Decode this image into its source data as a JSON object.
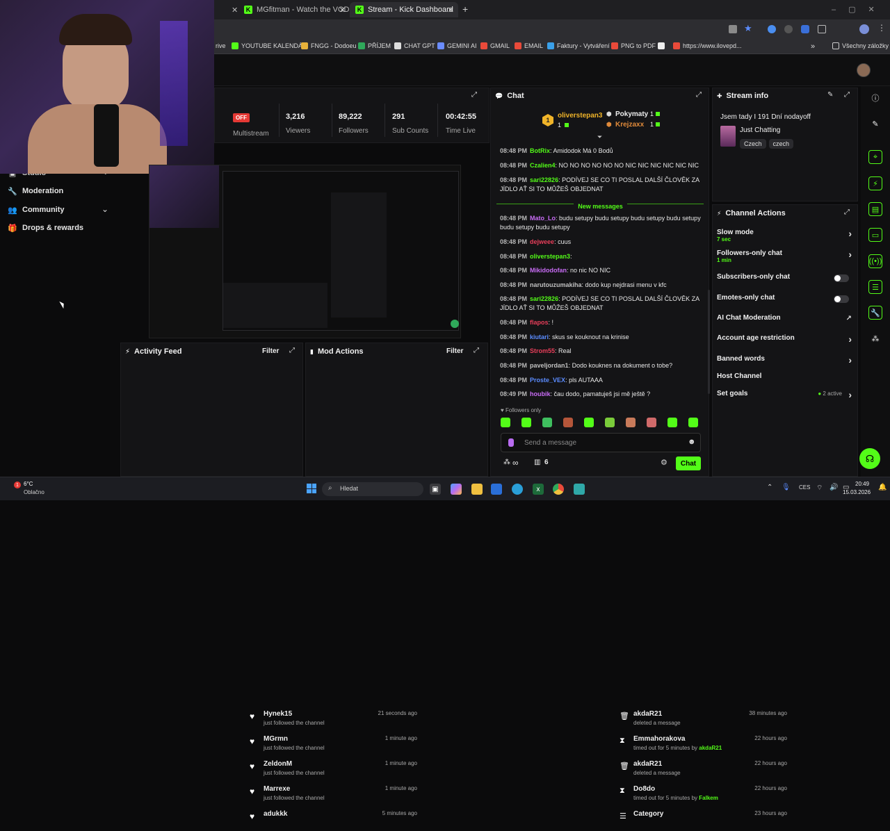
{
  "browser": {
    "tabs": [
      {
        "label": "MGfitman - Watch the VOD on"
      },
      {
        "label": "Stream - Kick Dashboard"
      }
    ],
    "new_tab": "+",
    "bookmarks": [
      "rive",
      "YOUTUBE KALENDÁŘ",
      "FNGG - Dodoeu",
      "PŘÍJEM",
      "CHAT GPT",
      "GEMINI AI",
      "GMAIL",
      "EMAIL",
      "Faktury - Vytváření",
      "PNG to PDF",
      "https://www.ilovepd...",
      "Všechny záložky"
    ],
    "more_bookmarks": "»"
  },
  "sidebar": {
    "partial": "Studio",
    "items": [
      {
        "label": "Moderation",
        "icon": "wrench-icon"
      },
      {
        "label": "Community",
        "icon": "people-icon"
      },
      {
        "label": "Drops & rewards",
        "icon": "gift-icon"
      }
    ]
  },
  "stats": {
    "off_badge": "OFF",
    "multistream": "Multistream",
    "items": [
      {
        "value": "3,216",
        "label": "Viewers"
      },
      {
        "value": "89,222",
        "label": "Followers"
      },
      {
        "value": "291",
        "label": "Sub Counts"
      },
      {
        "value": "00:42:55",
        "label": "Time Live"
      }
    ]
  },
  "activity_feed": {
    "title": "Activity Feed",
    "filter": "Filter",
    "items": [
      {
        "name": "Hynek15",
        "action": "just followed the channel",
        "time": "21 seconds ago"
      },
      {
        "name": "MGrmn",
        "action": "just followed the channel",
        "time": "1 minute ago"
      },
      {
        "name": "ZeldonM",
        "action": "just followed the channel",
        "time": "1 minute ago"
      },
      {
        "name": "Marrexe",
        "action": "just followed the channel",
        "time": "1 minute ago"
      },
      {
        "name": "adukkk",
        "action": "",
        "time": "5 minutes ago"
      }
    ]
  },
  "mod_actions": {
    "title": "Mod Actions",
    "filter": "Filter",
    "items": [
      {
        "name": "akdaR21",
        "action": "deleted a message",
        "by": "",
        "time": "38 minutes ago",
        "icon": "trash-icon"
      },
      {
        "name": "Emmahorakova",
        "action": "timed out for 5 minutes by",
        "by": "akdaR21",
        "time": "22 hours ago",
        "icon": "hourglass-icon"
      },
      {
        "name": "akdaR21",
        "action": "deleted a message",
        "by": "",
        "time": "22 hours ago",
        "icon": "trash-icon"
      },
      {
        "name": "Do8do",
        "action": "timed out for 5 minutes by",
        "by": "Falkem",
        "time": "22 hours ago",
        "icon": "hourglass-icon"
      },
      {
        "name": "Category",
        "action": "",
        "by": "",
        "time": "23 hours ago",
        "icon": "list-icon"
      }
    ]
  },
  "chat": {
    "title": "Chat",
    "top_gifters": [
      {
        "rank": "1",
        "name": "oliverstepan3",
        "count": "1"
      },
      {
        "name": "Pokymaty",
        "count": "1"
      },
      {
        "name": "Krejzaxx",
        "count": "1"
      }
    ],
    "new_messages": "New messages",
    "messages_before": [
      {
        "time": "08:48 PM",
        "user": "BotRix",
        "color": "#53fc18",
        "text": ": Amidodok Má 0 Bodů"
      },
      {
        "time": "08:48 PM",
        "user": "Czalien4",
        "color": "#53fc18",
        "text": ": NO NO NO NO NO NO NIC NIC NIC NIC NIC NIC"
      },
      {
        "time": "08:48 PM",
        "user": "sari22826",
        "color": "#53fc18",
        "text": ": PODÍVEJ SE CO TI POSLAL DALŠÍ ČLOVĚK ZA JÍDLO AŤ SI TO MŮŽEŠ OBJEDNAT"
      }
    ],
    "messages_after": [
      {
        "time": "08:48 PM",
        "user": "Mato_Lo",
        "color": "#c86cf5",
        "text": ": budu setupy budu setupy budu setupy budu setupy budu setupy budu setupy"
      },
      {
        "time": "08:48 PM",
        "user": "dejweee",
        "color": "#e83e5a",
        "text": ": cuus"
      },
      {
        "time": "08:48 PM",
        "user": "oliverstepan3",
        "color": "#53fc18",
        "text": ":"
      },
      {
        "time": "08:48 PM",
        "user": "Mikidodofan",
        "color": "#c86cf5",
        "text": ": no nic NO NIC"
      },
      {
        "time": "08:48 PM",
        "user": "narutouzumakiha",
        "color": "#c0c0c0",
        "text": ": dodo kup nejdrasi menu v kfc"
      },
      {
        "time": "08:48 PM",
        "user": "sari22826",
        "color": "#53fc18",
        "text": ": PODÍVEJ SE CO TI POSLAL DALŠÍ ČLOVĚK ZA JÍDLO AŤ SI TO MŮŽEŠ OBJEDNAT"
      },
      {
        "time": "08:48 PM",
        "user": "flapos",
        "color": "#e83e5a",
        "text": ": !"
      },
      {
        "time": "08:48 PM",
        "user": "kiutari",
        "color": "#5b8cff",
        "text": ": skus se kouknout na krinise"
      },
      {
        "time": "08:48 PM",
        "user": "Strom55",
        "color": "#e83e5a",
        "text": ": Real"
      },
      {
        "time": "08:48 PM",
        "user": "paveljordan1",
        "color": "#c0c0c0",
        "text": ": Dodo kouknes na dokument o tobe?"
      },
      {
        "time": "08:48 PM",
        "user": "Proste_VEX",
        "color": "#5b8cff",
        "text": ": pls AUTAAA"
      },
      {
        "time": "08:49 PM",
        "user": "houbik",
        "color": "#c86cf5",
        "text": ": čau dodo, pamatuješ jsi mě ještě ?"
      }
    ],
    "followers_only": "Followers only",
    "placeholder": "Send a message",
    "infinity": "∞",
    "count": "6",
    "send": "Chat"
  },
  "stream_info": {
    "title": "Stream info",
    "stream_title": "Jsem tady I 191 Dní nodayoff",
    "category": "Just Chatting",
    "tags": [
      "Czech",
      "czech"
    ]
  },
  "channel_actions": {
    "title": "Channel Actions",
    "items": [
      {
        "label": "Slow mode",
        "sub": "7 sec",
        "control": "chevron"
      },
      {
        "label": "Followers-only chat",
        "sub": "1 min",
        "control": "chevron"
      },
      {
        "label": "Subscribers-only chat",
        "sub": "",
        "control": "toggle"
      },
      {
        "label": "Emotes-only chat",
        "sub": "",
        "control": "toggle"
      },
      {
        "label": "AI Chat Moderation",
        "sub": "",
        "control": "external"
      },
      {
        "label": "Account age restriction",
        "sub": "",
        "control": "chevron"
      },
      {
        "label": "Banned words",
        "sub": "",
        "control": "chevron"
      },
      {
        "label": "Host Channel",
        "sub": "",
        "control": "none"
      },
      {
        "label": "Set goals",
        "sub": "",
        "control": "chevron"
      }
    ],
    "goals_active": "2 active"
  },
  "taskbar": {
    "weather_temp": "6°C",
    "weather_desc": "Oblačno",
    "search_placeholder": "Hledat",
    "lang": "CES",
    "time": "20:49",
    "date": "15.03.2026"
  },
  "colors": {
    "accent": "#53fc18",
    "bg": "#0b0b0c",
    "panel": "#141416"
  }
}
